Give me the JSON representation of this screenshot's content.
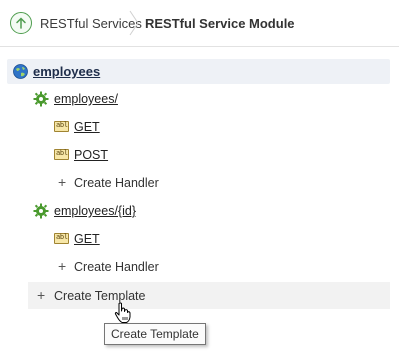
{
  "breadcrumb": {
    "up_icon": "up-arrow-circle-icon",
    "parent_label": "RESTful Services",
    "current_label": "RESTful Service Module"
  },
  "tree": {
    "module": {
      "label": "employees",
      "icon": "globe-icon"
    },
    "templates": [
      {
        "label": "employees/",
        "icon": "gear-icon",
        "handlers": [
          {
            "label": "GET",
            "icon": "abl-icon"
          },
          {
            "label": "POST",
            "icon": "abl-icon"
          }
        ],
        "create_handler_label": "Create Handler"
      },
      {
        "label": "employees/{id}",
        "icon": "gear-icon",
        "handlers": [
          {
            "label": "GET",
            "icon": "abl-icon"
          }
        ],
        "create_handler_label": "Create Handler"
      }
    ],
    "create_template_label": "Create Template"
  },
  "tooltip": {
    "text": "Create Template"
  },
  "colors": {
    "accent_green": "#4f9d4f",
    "root_row_bg": "#eef1f6",
    "hover_row_bg": "#f2f2f2"
  }
}
